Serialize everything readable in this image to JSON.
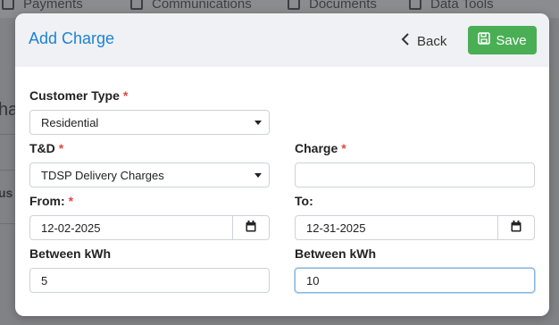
{
  "background": {
    "nav_items": [
      "Payments",
      "Communications",
      "Documents",
      "Data Tools"
    ],
    "fragments": {
      "left_text_1": "ha",
      "left_text_2": "us"
    }
  },
  "modal": {
    "title": "Add Charge",
    "back_label": "Back",
    "save_label": "Save",
    "fields": {
      "customer_type": {
        "label": "Customer Type",
        "required": "*",
        "value": "Residential"
      },
      "td": {
        "label": "T&D",
        "required": "*",
        "value": "TDSP Delivery Charges"
      },
      "charge": {
        "label": "Charge",
        "required": "*",
        "value": ""
      },
      "from": {
        "label": "From:",
        "required": "*",
        "value": "12-02-2025"
      },
      "to": {
        "label": "To:",
        "value": "12-31-2025"
      },
      "between_kwh_min": {
        "label": "Between kWh",
        "value": "5"
      },
      "between_kwh_max": {
        "label": "Between kWh",
        "value": "10"
      }
    }
  },
  "colors": {
    "title_blue": "#1e82d2",
    "save_green": "#4aae55",
    "required_red": "#e04848"
  },
  "icons": [
    "chevron-left-icon",
    "floppy-disk-icon",
    "calendar-icon",
    "caret-down-icon"
  ]
}
